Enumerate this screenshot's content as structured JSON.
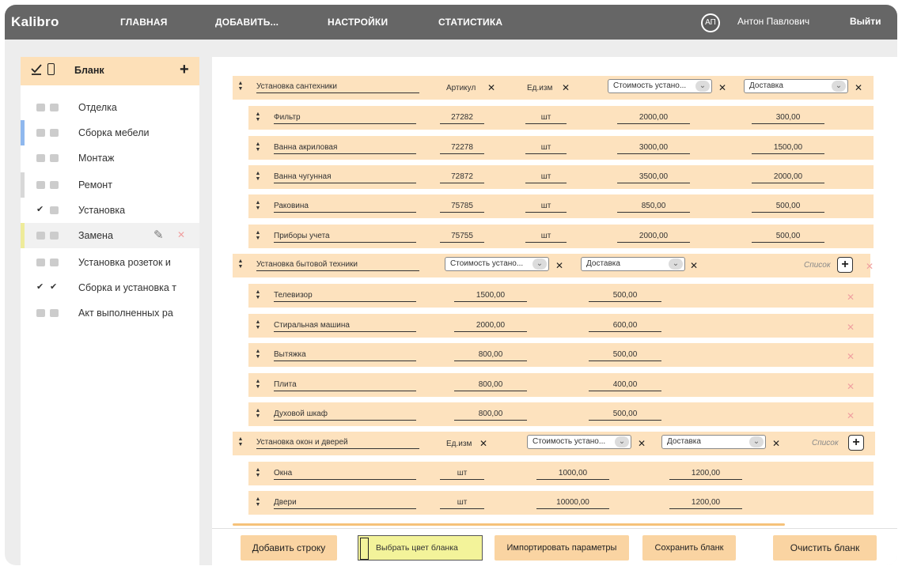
{
  "header": {
    "logo": "Kalibro",
    "nav": [
      "ГЛАВНАЯ",
      "ДОБАВИТЬ...",
      "НАСТРОЙКИ",
      "СТАТИСТИКА"
    ],
    "avatar": "АП",
    "user": "Антон Павлович",
    "logout": "Выйти"
  },
  "sidebar": {
    "title": "Бланк",
    "add": "+",
    "items": [
      {
        "label": "Отделка",
        "checked": [
          false,
          false
        ],
        "marker": ""
      },
      {
        "label": "Сборка мебели",
        "checked": [
          false,
          false
        ],
        "marker": "#8fb8ee"
      },
      {
        "label": "Монтаж",
        "checked": [
          false,
          false
        ],
        "marker": ""
      },
      {
        "label": "Ремонт",
        "checked": [
          false,
          false
        ],
        "marker": "#d8d8d8"
      },
      {
        "label": "Установка",
        "checked": [
          true,
          false
        ],
        "marker": ""
      },
      {
        "label": "Замена",
        "checked": [
          false,
          false
        ],
        "marker": "#eeeb9a"
      },
      {
        "label": "Установка розеток и",
        "checked": [
          false,
          false
        ],
        "marker": ""
      },
      {
        "label": "Сборка и установка т",
        "checked": [
          true,
          true
        ],
        "marker": ""
      },
      {
        "label": "Акт выполненных ра",
        "checked": [
          false,
          false
        ],
        "marker": ""
      }
    ]
  },
  "groups": [
    {
      "title": "Установка сантехники",
      "tags": [
        "Артикул",
        "Ед.изм"
      ],
      "selects": [
        "Стоимость устано...",
        "Доставка"
      ],
      "rows": [
        {
          "name": "Фильтр",
          "article": "27282",
          "unit": "шт",
          "cost": "2000,00",
          "delivery": "300,00"
        },
        {
          "name": "Ванна акриловая",
          "article": "72278",
          "unit": "шт",
          "cost": "3000,00",
          "delivery": "1500,00"
        },
        {
          "name": "Ванна чугунная",
          "article": "72872",
          "unit": "шт",
          "cost": "3500,00",
          "delivery": "2000,00"
        },
        {
          "name": "Раковина",
          "article": "75785",
          "unit": "шт",
          "cost": "850,00",
          "delivery": "500,00"
        },
        {
          "name": "Приборы учета",
          "article": "75755",
          "unit": "шт",
          "cost": "2000,00",
          "delivery": "500,00"
        }
      ]
    },
    {
      "title": "Установка бытовой техники",
      "selects": [
        "Стоимость устано...",
        "Доставка"
      ],
      "list": "Список",
      "rows": [
        {
          "name": "Телевизор",
          "cost": "1500,00",
          "delivery": "500,00"
        },
        {
          "name": "Стиральная машина",
          "cost": "2000,00",
          "delivery": "600,00"
        },
        {
          "name": "Вытяжка",
          "cost": "800,00",
          "delivery": "500,00"
        },
        {
          "name": "Плита",
          "cost": "800,00",
          "delivery": "400,00"
        },
        {
          "name": "Духовой шкаф",
          "cost": "800,00",
          "delivery": "500,00"
        }
      ]
    },
    {
      "title": "Установка окон и дверей",
      "tags": [
        "Ед.изм"
      ],
      "selects": [
        "Стоимость устано...",
        "Доставка"
      ],
      "list": "Список",
      "rows": [
        {
          "name": "Окна",
          "unit": "шт",
          "cost": "1000,00",
          "delivery": "1200,00"
        },
        {
          "name": "Двери",
          "unit": "шт",
          "cost": "10000,00",
          "delivery": "1200,00"
        }
      ]
    }
  ],
  "footer": {
    "add_row": "Добавить строку",
    "pick_color": "Выбрать цвет бланка",
    "import": "Импортировать параметры",
    "save": "Сохранить бланк",
    "clear": "Очистить бланк"
  },
  "colors": {
    "topbar": "#666666",
    "accent": "#fde2be",
    "button": "#fad4a2",
    "color_swatch": "#f3f39a"
  }
}
